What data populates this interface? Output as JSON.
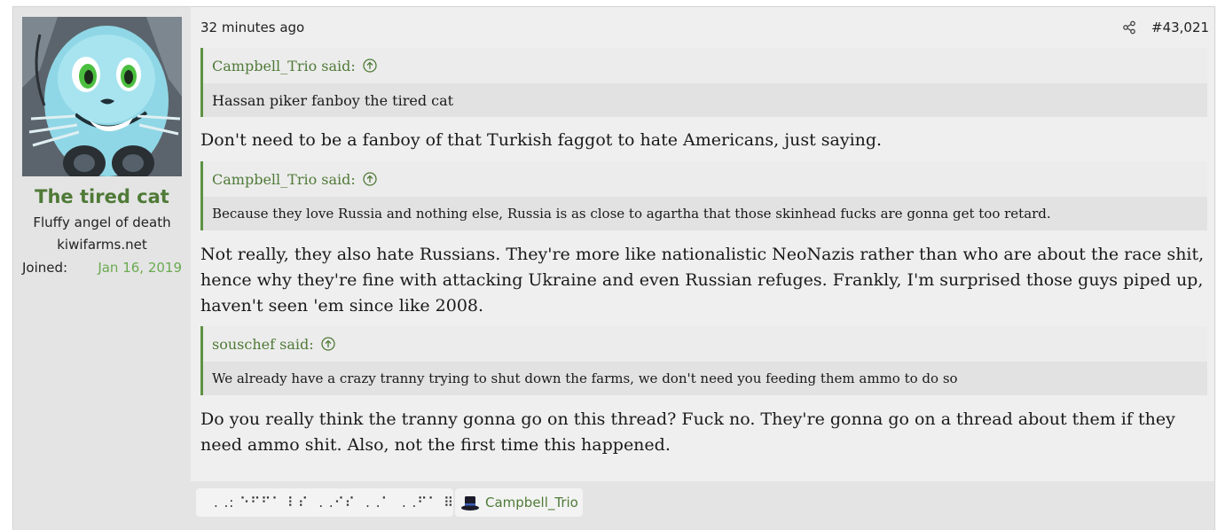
{
  "user": {
    "name": "The tired cat",
    "title": "Fluffy angel of death",
    "website": "kiwifarms.net",
    "joined_label": "Joined:",
    "joined_value": "Jan 16, 2019"
  },
  "post": {
    "timestamp": "32 minutes ago",
    "number": "#43,021",
    "blocks": [
      {
        "type": "quote",
        "author": "Campbell_Trio said:",
        "text": "Hassan piker fanboy the tired cat"
      },
      {
        "type": "text",
        "text": "Don't need to be a fanboy of that Turkish faggot to hate Americans, just saying."
      },
      {
        "type": "quote",
        "author": "Campbell_Trio said:",
        "text": "Because they love Russia and nothing else, Russia is as close to agartha that those skinhead fucks are gonna get too retard."
      },
      {
        "type": "text",
        "text": "Not really, they also hate Russians. They're more like nationalistic NeoNazis rather than who are about the race shit, hence why they're fine with attacking Ukraine and even Russian refuges. Frankly, I'm surprised those guys piped up, haven't seen 'em since like 2008."
      },
      {
        "type": "quote",
        "author": "souschef said:",
        "text": "We already have a crazy tranny trying to shut down the farms, we don't need you feeding them ammo to do so"
      },
      {
        "type": "text",
        "text": "Do you really think the tranny gonna go on this thread? Fuck no. They're gonna go on a thread about them if they need ammo shit. Also, not the first time this happened."
      }
    ]
  },
  "reactions": {
    "like_users_text": ". .: ⠑⠋⠋⠁ ⠇⠎  . .⠊⠎  . .⠁  . .⠋⠁ ⠿",
    "reactor": "Campbell_Trio"
  },
  "colors": {
    "accent": "#4f7a37",
    "joined_date": "#6aaa50",
    "quote_border": "#5d9244",
    "like_blue": "#2f7fd6"
  },
  "icons": {
    "share": "share-icon",
    "quote_jump": "arrow-up-circle-icon",
    "like": "thumbs-up-icon",
    "reactor_badge": "top-hat-icon"
  }
}
